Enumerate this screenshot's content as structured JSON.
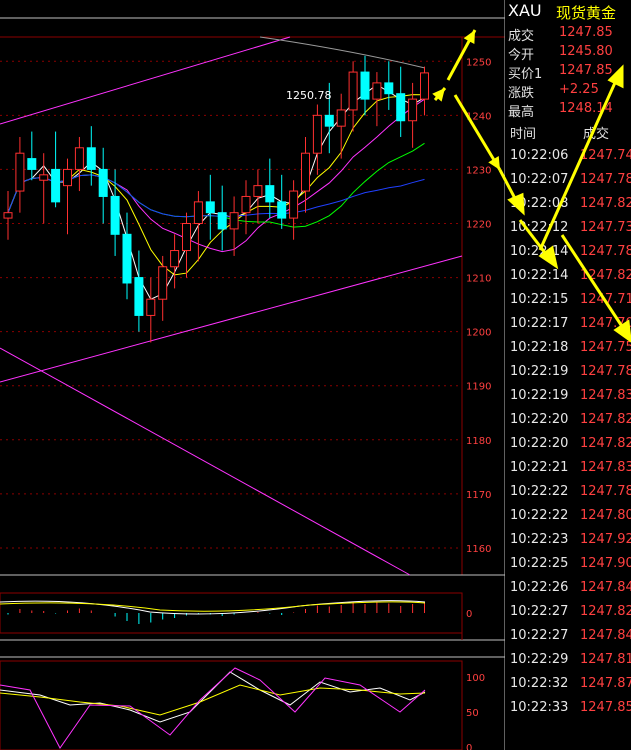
{
  "header": {
    "symbol": "XAU",
    "name": "现货黄金"
  },
  "quote": [
    {
      "label": "成交",
      "value": "1247.85"
    },
    {
      "label": "今开",
      "value": "1245.80"
    },
    {
      "label": "买价1",
      "value": "1247.85"
    },
    {
      "label": "涨跌",
      "value": "+2.25"
    },
    {
      "label": "最高",
      "value": "1248.14"
    }
  ],
  "ticks_header": {
    "time": "时间",
    "price": "成交"
  },
  "ticks": [
    {
      "time": "10:22:06",
      "price": "1247.74"
    },
    {
      "time": "10:22:07",
      "price": "1247.78"
    },
    {
      "time": "10:22:08",
      "price": "1247.82"
    },
    {
      "time": "10:22:12",
      "price": "1247.73"
    },
    {
      "time": "10:22:14",
      "price": "1247.78"
    },
    {
      "time": "10:22:14",
      "price": "1247.82"
    },
    {
      "time": "10:22:15",
      "price": "1247.71"
    },
    {
      "time": "10:22:17",
      "price": "1247.70"
    },
    {
      "time": "10:22:18",
      "price": "1247.75"
    },
    {
      "time": "10:22:19",
      "price": "1247.78"
    },
    {
      "time": "10:22:19",
      "price": "1247.83"
    },
    {
      "time": "10:22:20",
      "price": "1247.82"
    },
    {
      "time": "10:22:20",
      "price": "1247.82"
    },
    {
      "time": "10:22:21",
      "price": "1247.83"
    },
    {
      "time": "10:22:22",
      "price": "1247.78"
    },
    {
      "time": "10:22:22",
      "price": "1247.80"
    },
    {
      "time": "10:22:23",
      "price": "1247.92"
    },
    {
      "time": "10:22:25",
      "price": "1247.90"
    },
    {
      "time": "10:22:26",
      "price": "1247.84"
    },
    {
      "time": "10:22:27",
      "price": "1247.82"
    },
    {
      "time": "10:22:27",
      "price": "1247.84"
    },
    {
      "time": "10:22:29",
      "price": "1247.81"
    },
    {
      "time": "10:22:32",
      "price": "1247.87"
    },
    {
      "time": "10:22:33",
      "price": "1247.85"
    }
  ],
  "chart": {
    "price_ticks": [
      "1250",
      "1240",
      "1230",
      "1220",
      "1210",
      "1200",
      "1190",
      "1180",
      "1170",
      "1160"
    ],
    "high_label": "1250.78",
    "macd_ticks": [
      "0"
    ],
    "kdj_ticks": [
      "100",
      "50",
      "0"
    ],
    "colors": {
      "up": "#ff3030",
      "down": "#00ffff",
      "grid": "#8b0000",
      "arrow": "#ffff00"
    }
  },
  "chart_data": {
    "type": "candlestick",
    "ylim": [
      1155,
      1258
    ],
    "candles": [
      [
        1221,
        1226,
        1217,
        1222
      ],
      [
        1226,
        1236,
        1222,
        1233
      ],
      [
        1232,
        1237,
        1228,
        1230
      ],
      [
        1228,
        1233,
        1220,
        1229
      ],
      [
        1230,
        1237,
        1223,
        1224
      ],
      [
        1227,
        1232,
        1218,
        1230
      ],
      [
        1230,
        1236,
        1226,
        1234
      ],
      [
        1234,
        1238,
        1227,
        1230
      ],
      [
        1230,
        1234,
        1220,
        1225
      ],
      [
        1225,
        1230,
        1214,
        1218
      ],
      [
        1218,
        1222,
        1206,
        1209
      ],
      [
        1210,
        1215,
        1200,
        1203
      ],
      [
        1203,
        1210,
        1198,
        1206
      ],
      [
        1206,
        1214,
        1202,
        1212
      ],
      [
        1212,
        1218,
        1208,
        1215
      ],
      [
        1215,
        1222,
        1210,
        1220
      ],
      [
        1220,
        1226,
        1213,
        1224
      ],
      [
        1224,
        1229,
        1217,
        1222
      ],
      [
        1222,
        1227,
        1215,
        1219
      ],
      [
        1219,
        1225,
        1214,
        1222
      ],
      [
        1222,
        1228,
        1218,
        1225
      ],
      [
        1225,
        1230,
        1220,
        1227
      ],
      [
        1227,
        1232,
        1221,
        1224
      ],
      [
        1224,
        1229,
        1219,
        1221
      ],
      [
        1221,
        1228,
        1217,
        1226
      ],
      [
        1226,
        1236,
        1222,
        1233
      ],
      [
        1233,
        1242,
        1229,
        1240
      ],
      [
        1240,
        1246,
        1233,
        1238
      ],
      [
        1238,
        1244,
        1232,
        1241
      ],
      [
        1241,
        1250,
        1237,
        1248
      ],
      [
        1248,
        1251,
        1240,
        1243
      ],
      [
        1243,
        1248,
        1238,
        1246
      ],
      [
        1246,
        1250,
        1241,
        1244
      ],
      [
        1244,
        1249,
        1236,
        1239
      ],
      [
        1239,
        1246,
        1234,
        1243
      ],
      [
        1243,
        1249,
        1240,
        1247.85
      ]
    ]
  }
}
